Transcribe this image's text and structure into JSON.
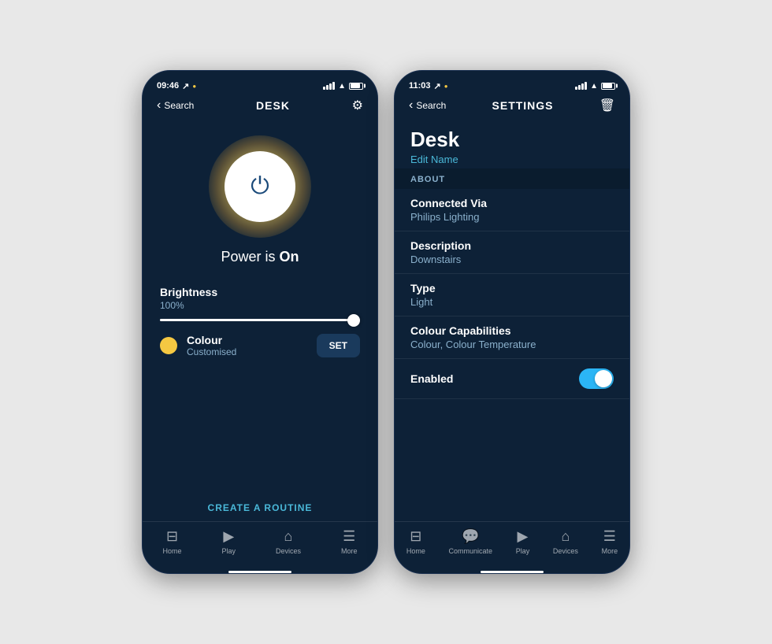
{
  "leftPhone": {
    "statusBar": {
      "time": "09:46",
      "searchLabel": "Search"
    },
    "header": {
      "title": "DESK",
      "backLabel": "‹"
    },
    "power": {
      "statusText": "Power is ",
      "statusBold": "On"
    },
    "brightness": {
      "label": "Brightness",
      "percentage": "100%"
    },
    "colour": {
      "label": "Colour",
      "sublabel": "Customised",
      "setButton": "SET"
    },
    "routine": {
      "label": "CREATE A ROUTINE"
    },
    "bottomNav": [
      {
        "icon": "🏠",
        "label": "Home"
      },
      {
        "icon": "▶",
        "label": "Play"
      },
      {
        "icon": "⌂",
        "label": "Devices"
      },
      {
        "icon": "☰",
        "label": "More"
      }
    ]
  },
  "rightPhone": {
    "statusBar": {
      "time": "11:03",
      "searchLabel": "Search"
    },
    "header": {
      "title": "SETTINGS",
      "backLabel": "‹"
    },
    "deviceName": "Desk",
    "editName": "Edit Name",
    "aboutSection": "ABOUT",
    "settings": [
      {
        "label": "Connected Via",
        "value": "Philips Lighting"
      },
      {
        "label": "Description",
        "value": "Downstairs"
      },
      {
        "label": "Type",
        "value": "Light"
      },
      {
        "label": "Colour Capabilities",
        "value": "Colour, Colour Temperature"
      }
    ],
    "enabled": {
      "label": "Enabled",
      "state": true
    },
    "bottomNav": [
      {
        "icon": "🏠",
        "label": "Home"
      },
      {
        "icon": "💬",
        "label": "Communicate"
      },
      {
        "icon": "▶",
        "label": "Play"
      },
      {
        "icon": "⌂",
        "label": "Devices"
      },
      {
        "icon": "☰",
        "label": "More"
      }
    ]
  }
}
